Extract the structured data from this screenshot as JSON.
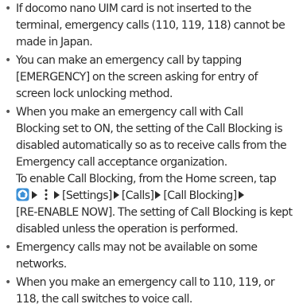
{
  "notes": [
    {
      "lines": [
        "If docomo nano UIM card is not inserted to the",
        "terminal, emergency calls (110, 119, 118) cannot be",
        "made in Japan."
      ]
    },
    {
      "lines": [
        "You can make an emergency call by tapping",
        "[EMERGENCY] on the screen asking for entry of",
        "screen lock unlocking method."
      ]
    },
    {
      "lines": [
        "When you make an emergency call with Call",
        "Blocking set to ON, the setting of the Call Blocking is",
        "disabled automatically so as to receive calls from the",
        "Emergency call acceptance organization.",
        "To enable Call Blocking, from the Home screen, tap"
      ],
      "path": {
        "step_settings": "[Settings]",
        "step_calls": "[Calls]",
        "step_call_blocking": "[Call Blocking]",
        "step_reenable": "[RE-ENABLE NOW]",
        "tail_first": ". The setting of Call Blocking is kept",
        "tail_second": "disabled unless the operation is performed."
      },
      "icons": {
        "home": "home-screen-icon",
        "menu": "overflow-menu-icon",
        "arrow": "right-triangle-arrow",
        "home_color": "#3a8fd6"
      }
    },
    {
      "lines": [
        "Emergency calls may not be available on some",
        "networks."
      ]
    },
    {
      "lines": [
        "When you make an emergency call to 110, 119, or",
        "118, the call switches to voice call."
      ]
    }
  ]
}
